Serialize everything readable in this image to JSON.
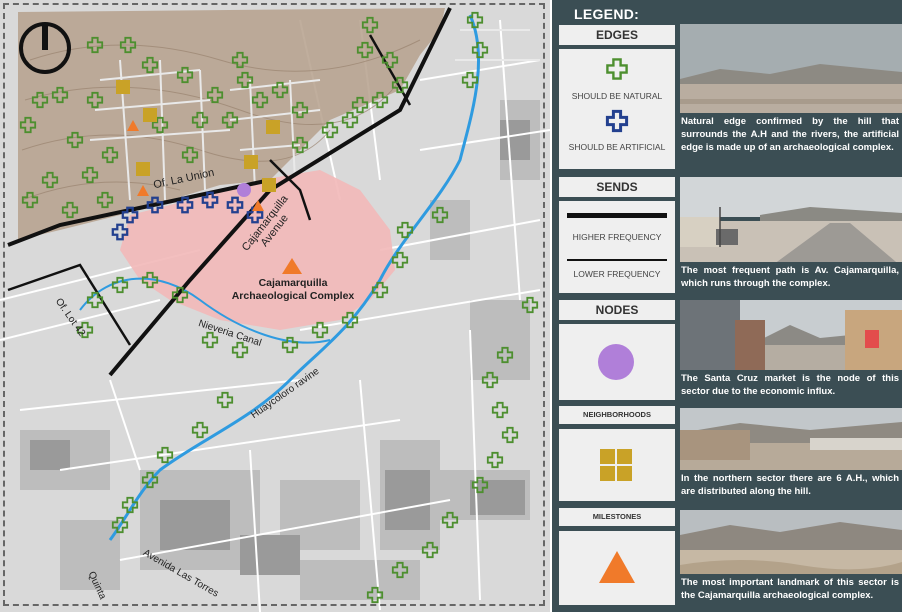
{
  "map": {
    "labels": {
      "of_la_union": "Of. La Union",
      "cajamarquilla_avenue": "Cajamarquilla Avenue",
      "cajamarquilla_complex": "Cajamarquilla Archaeological Complex",
      "of_lot_42": "Of. Lot 42",
      "nieveria_canal": "Nieveria Canal",
      "huaycoloro_ravine": "Huaycoloro ravine",
      "avenida_las_torres": "Avenida Las Torres",
      "quinta": "Quinta"
    },
    "colors": {
      "hill": "#b5a08c",
      "archaeological_zone": "#f2b8b8",
      "natural_edge": "#4d8f2f",
      "artificial_edge": "#23408f",
      "river": "#2f9be0",
      "node": "#b07fd9",
      "neighborhood": "#c9a227",
      "milestone": "#f07a2a"
    },
    "compass_icon": "power-icon"
  },
  "legend": {
    "title": "LEGEND:",
    "edges": {
      "title": "EDGES",
      "natural_label": "SHOULD BE NATURAL",
      "artificial_label": "SHOULD BE ARTIFICIAL"
    },
    "sends": {
      "title": "SENDS",
      "higher_label": "HIGHER FREQUENCY",
      "lower_label": "LOWER FREQUENCY"
    },
    "nodes": {
      "title": "NODES"
    },
    "neighborhoods": {
      "title": "NEIGHBORHOODS"
    },
    "milestones": {
      "title": "MILESTONES"
    }
  },
  "photos": [
    {
      "caption": "Natural edge confirmed by the hill that surrounds the A.H and the rivers, the artificial edge is made up of an archaeological complex."
    },
    {
      "caption": "The most frequent path is Av. Cajamarquilla, which runs through the complex."
    },
    {
      "caption": "The Santa Cruz market is the node of this sector due to the economic influx."
    },
    {
      "caption": "In the northern sector there are 6 A.H., which are distributed along the hill."
    },
    {
      "caption": "The most important landmark of this sector is the Cajamarquilla archaeological complex."
    }
  ]
}
